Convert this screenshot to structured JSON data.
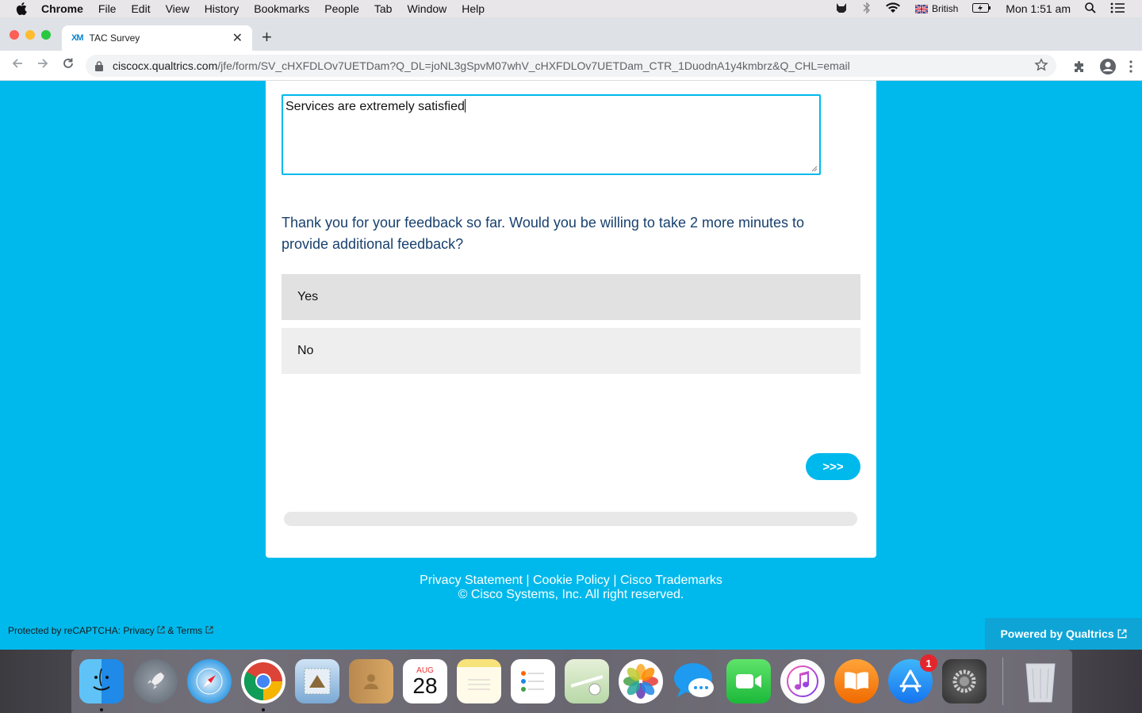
{
  "menubar": {
    "items": [
      "Chrome",
      "File",
      "Edit",
      "View",
      "History",
      "Bookmarks",
      "People",
      "Tab",
      "Window",
      "Help"
    ],
    "input_source": "British",
    "clock": "Mon 1:51 am"
  },
  "browser": {
    "tab_title": "TAC Survey",
    "tab_favicon": "XM",
    "new_tab_label": "+",
    "url_host": "ciscocx.qualtrics.com",
    "url_path": "/jfe/form/SV_cHXFDLOv7UETDam?Q_DL=joNL3gSpvM07whV_cHXFDLOv7UETDam_CTR_1DuodnA1y4kmbrz&Q_CHL=email"
  },
  "survey": {
    "comment_value": "Services are extremely satisfied",
    "question": "Thank you for your feedback so far. Would you be willing to take 2 more minutes to provide additional feedback?",
    "choices": [
      "Yes",
      "No"
    ],
    "next_label": ">>>",
    "progress_fraction": 0.0
  },
  "footer": {
    "privacy": "Privacy Statement",
    "cookie": "Cookie Policy",
    "trademarks": "Cisco Trademarks",
    "separator": " | ",
    "copyright": "© Cisco Systems, Inc. All right reserved.",
    "recaptcha_prefix": "Protected by reCAPTCHA: ",
    "recaptcha_privacy": "Privacy",
    "recaptcha_and": " & ",
    "recaptcha_terms": "Terms",
    "powered": "Powered by Qualtrics"
  },
  "dock": {
    "calendar_month": "AUG",
    "calendar_day": "28",
    "appstore_badge": "1"
  },
  "colors": {
    "page_bg": "#00b9ec",
    "question_text": "#18406e",
    "choice_bg": "#eeeeee",
    "choice_hover_bg": "#e1e1e1"
  }
}
